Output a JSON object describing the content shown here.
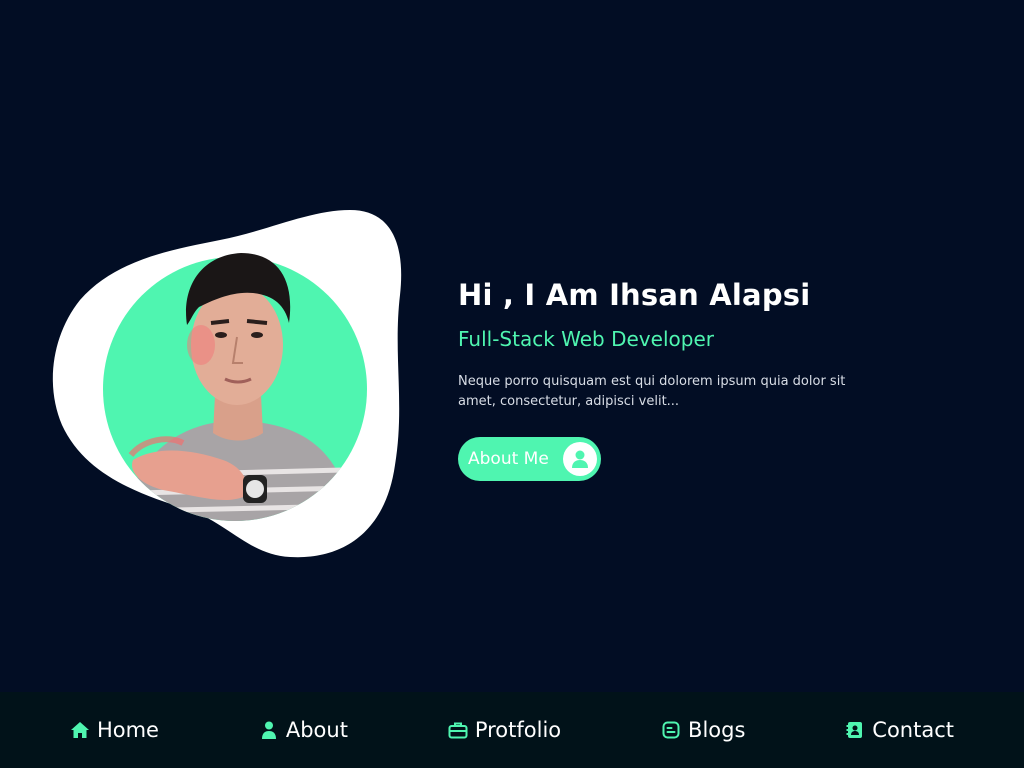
{
  "hero": {
    "title": "Hi , I Am Ihsan Alapsi",
    "subtitle": "Full-Stack Web Developer",
    "description": "Neque porro quisquam est qui dolorem ipsum quia dolor sit amet, consectetur, adipisci velit...",
    "button_label": "About Me",
    "button_icon": "user-icon"
  },
  "nav": {
    "items": [
      {
        "label": "Home",
        "icon": "home-icon"
      },
      {
        "label": "About",
        "icon": "user-icon"
      },
      {
        "label": "Protfolio",
        "icon": "briefcase-icon"
      },
      {
        "label": "Blogs",
        "icon": "blog-icon"
      },
      {
        "label": "Contact",
        "icon": "contact-icon"
      }
    ]
  },
  "colors": {
    "background": "#020d24",
    "accent": "#4ff5b0",
    "nav_background": "#011219",
    "blob": "#ffffff",
    "text": "#ffffff"
  }
}
